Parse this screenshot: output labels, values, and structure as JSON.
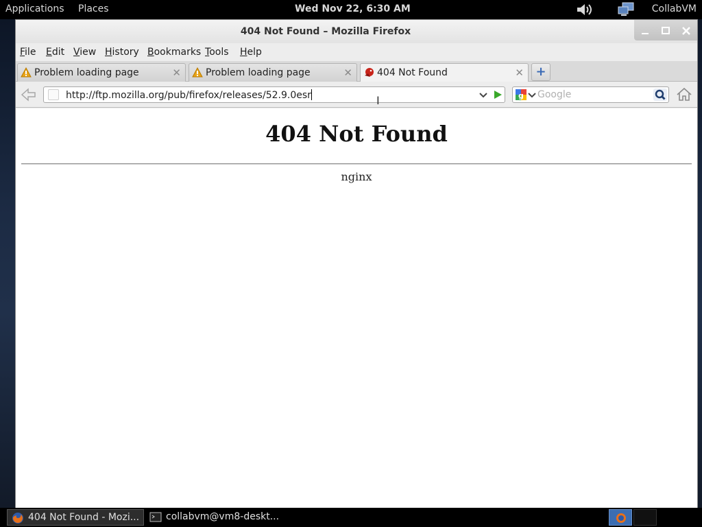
{
  "top_panel": {
    "applications": "Applications",
    "places": "Places",
    "clock": "Wed Nov 22,  6:30 AM",
    "user": "CollabVM"
  },
  "window": {
    "title": "404 Not Found – Mozilla Firefox"
  },
  "menubar": {
    "items": [
      {
        "label": "File",
        "key": "F",
        "rest": "ile"
      },
      {
        "label": "Edit",
        "key": "E",
        "rest": "dit"
      },
      {
        "label": "View",
        "key": "V",
        "rest": "iew"
      },
      {
        "label": "History",
        "key": "H",
        "rest": "istory"
      },
      {
        "label": "Bookmarks",
        "key": "B",
        "rest": "ookmarks"
      },
      {
        "label": "Tools",
        "key": "T",
        "rest": "ools"
      },
      {
        "label": "Help",
        "key": "H",
        "rest": "elp"
      }
    ]
  },
  "tabs": [
    {
      "label": "Problem loading page",
      "icon": "warning-icon"
    },
    {
      "label": "Problem loading page",
      "icon": "warning-icon"
    },
    {
      "label": "404 Not Found",
      "icon": "site-favicon-icon",
      "active": true
    }
  ],
  "navbar": {
    "url": "http://ftp.mozilla.org/pub/firefox/releases/52.9.0esr",
    "search_placeholder": "Google"
  },
  "page": {
    "heading": "404 Not Found",
    "server": "nginx"
  },
  "taskbar": {
    "tasks": [
      {
        "label": "404 Not Found - Mozi...",
        "icon": "firefox-icon",
        "active": true
      },
      {
        "label": "collabvm@vm8-deskt...",
        "icon": "terminal-icon",
        "active": false
      }
    ]
  },
  "colors": {
    "accent": "#3b6db2",
    "go_arrow": "#3aa82a",
    "warning": "#e8a317"
  }
}
